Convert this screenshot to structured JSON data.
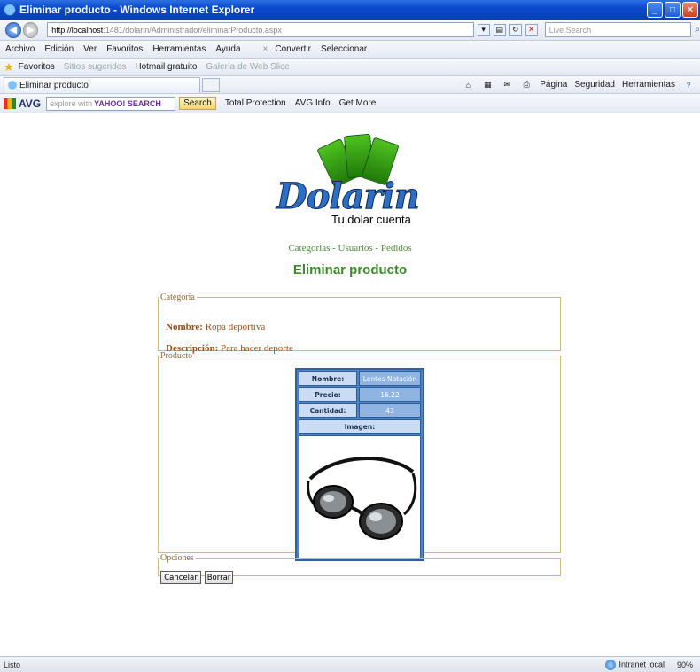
{
  "window": {
    "title": "Eliminar producto - Windows Internet Explorer"
  },
  "address": {
    "url_host": "http://localhost",
    "url_rest": ":1481/dolarin/Administrador/eliminarProducto.aspx",
    "search_placeholder": "Live Search"
  },
  "menu": {
    "archivo": "Archivo",
    "edicion": "Edición",
    "ver": "Ver",
    "favoritos": "Favoritos",
    "herramientas": "Herramientas",
    "ayuda": "Ayuda",
    "close_x": "×",
    "convertir": "Convertir",
    "seleccionar": "Seleccionar"
  },
  "favbar": {
    "favoritos": "Favoritos",
    "sitios": "Sitios sugeridos",
    "hotmail": "Hotmail gratuito",
    "galeria": "Galería de Web Slice"
  },
  "tabbar": {
    "tab_title": "Eliminar producto",
    "pagina": "Página",
    "seguridad": "Seguridad",
    "herramientas": "Herramientas"
  },
  "avgbar": {
    "logo": "AVG",
    "search_hint": "explore with",
    "yahoo": "YAHOO! SEARCH",
    "search_btn": "Search",
    "total_protection": "Total Protection",
    "avg_info": "AVG Info",
    "get_more": "Get More"
  },
  "logo": {
    "name": "Dolarin",
    "tagline": "Tu dolar cuenta"
  },
  "nav": {
    "categorias": "Categorias",
    "sep": " - ",
    "usuarios": "Usuarios",
    "pedidos": "Pedidos"
  },
  "page": {
    "title": "Eliminar producto"
  },
  "categoria": {
    "legend": "Categoria",
    "nombre_label": "Nombre:",
    "nombre_value": "Ropa deportiva",
    "descripcion_label": "Descripción:",
    "descripcion_value": "Para hacer deporte"
  },
  "producto": {
    "legend": "Producto",
    "nombre_label": "Nombre:",
    "nombre_value": "Lentes Natación",
    "precio_label": "Precio:",
    "precio_value": "16.22",
    "cantidad_label": "Cantidad:",
    "cantidad_value": "43",
    "imagen_label": "Imagen:"
  },
  "opciones": {
    "legend": "Opciones",
    "cancelar": "Cancelar",
    "borrar": "Borrar"
  },
  "status": {
    "text": "Listo",
    "zone": "Intranet local",
    "zoom": "90%"
  },
  "colors": {
    "accent_green": "#3b8a2a",
    "fieldset_border": "#d6b77e",
    "table_blue": "#4d83c7"
  }
}
